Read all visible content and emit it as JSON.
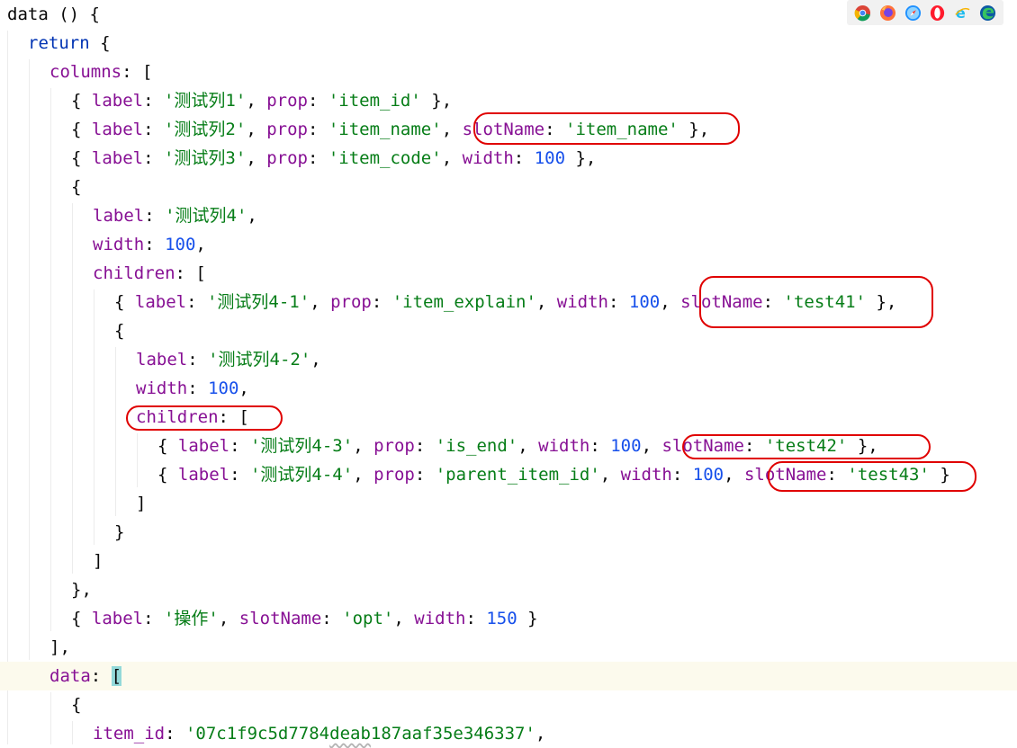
{
  "editor": {
    "lines": [
      {
        "tokens": [
          {
            "t": "data",
            "c": "p"
          },
          {
            "t": " () {",
            "c": "p"
          }
        ]
      },
      {
        "tokens": [
          {
            "t": "return",
            "c": "kw"
          },
          {
            "t": " {",
            "c": "p"
          }
        ]
      },
      {
        "tokens": [
          {
            "t": "columns",
            "c": "key"
          },
          {
            "t": ": [",
            "c": "p"
          }
        ]
      },
      {
        "tokens": [
          {
            "t": "{ ",
            "c": "p"
          },
          {
            "t": "label",
            "c": "key"
          },
          {
            "t": ": ",
            "c": "p"
          },
          {
            "t": "'测试列1'",
            "c": "str"
          },
          {
            "t": ", ",
            "c": "p"
          },
          {
            "t": "prop",
            "c": "key"
          },
          {
            "t": ": ",
            "c": "p"
          },
          {
            "t": "'item_id'",
            "c": "str"
          },
          {
            "t": " },",
            "c": "p"
          }
        ]
      },
      {
        "tokens": [
          {
            "t": "{ ",
            "c": "p"
          },
          {
            "t": "label",
            "c": "key"
          },
          {
            "t": ": ",
            "c": "p"
          },
          {
            "t": "'测试列2'",
            "c": "str"
          },
          {
            "t": ", ",
            "c": "p"
          },
          {
            "t": "prop",
            "c": "key"
          },
          {
            "t": ": ",
            "c": "p"
          },
          {
            "t": "'item_name'",
            "c": "str"
          },
          {
            "t": ", ",
            "c": "p"
          },
          {
            "t": "slotName",
            "c": "key"
          },
          {
            "t": ": ",
            "c": "p"
          },
          {
            "t": "'item_name'",
            "c": "str"
          },
          {
            "t": " },",
            "c": "p"
          }
        ]
      },
      {
        "tokens": [
          {
            "t": "{ ",
            "c": "p"
          },
          {
            "t": "label",
            "c": "key"
          },
          {
            "t": ": ",
            "c": "p"
          },
          {
            "t": "'测试列3'",
            "c": "str"
          },
          {
            "t": ", ",
            "c": "p"
          },
          {
            "t": "prop",
            "c": "key"
          },
          {
            "t": ": ",
            "c": "p"
          },
          {
            "t": "'item_code'",
            "c": "str"
          },
          {
            "t": ", ",
            "c": "p"
          },
          {
            "t": "width",
            "c": "key"
          },
          {
            "t": ": ",
            "c": "p"
          },
          {
            "t": "100",
            "c": "num"
          },
          {
            "t": " },",
            "c": "p"
          }
        ]
      },
      {
        "tokens": [
          {
            "t": "{",
            "c": "p"
          }
        ]
      },
      {
        "tokens": [
          {
            "t": "label",
            "c": "key"
          },
          {
            "t": ": ",
            "c": "p"
          },
          {
            "t": "'测试列4'",
            "c": "str"
          },
          {
            "t": ",",
            "c": "p"
          }
        ]
      },
      {
        "tokens": [
          {
            "t": "width",
            "c": "key"
          },
          {
            "t": ": ",
            "c": "p"
          },
          {
            "t": "100",
            "c": "num"
          },
          {
            "t": ",",
            "c": "p"
          }
        ]
      },
      {
        "tokens": [
          {
            "t": "children",
            "c": "key"
          },
          {
            "t": ": [",
            "c": "p"
          }
        ]
      },
      {
        "tokens": [
          {
            "t": "{ ",
            "c": "p"
          },
          {
            "t": "label",
            "c": "key"
          },
          {
            "t": ": ",
            "c": "p"
          },
          {
            "t": "'测试列4-1'",
            "c": "str"
          },
          {
            "t": ", ",
            "c": "p"
          },
          {
            "t": "prop",
            "c": "key"
          },
          {
            "t": ": ",
            "c": "p"
          },
          {
            "t": "'item_explain'",
            "c": "str"
          },
          {
            "t": ", ",
            "c": "p"
          },
          {
            "t": "width",
            "c": "key"
          },
          {
            "t": ": ",
            "c": "p"
          },
          {
            "t": "100",
            "c": "num"
          },
          {
            "t": ", ",
            "c": "p"
          },
          {
            "t": "slotName",
            "c": "key"
          },
          {
            "t": ": ",
            "c": "p"
          },
          {
            "t": "'test41'",
            "c": "str"
          },
          {
            "t": " },",
            "c": "p"
          }
        ]
      },
      {
        "tokens": [
          {
            "t": "{",
            "c": "p"
          }
        ]
      },
      {
        "tokens": [
          {
            "t": "label",
            "c": "key"
          },
          {
            "t": ": ",
            "c": "p"
          },
          {
            "t": "'测试列4-2'",
            "c": "str"
          },
          {
            "t": ",",
            "c": "p"
          }
        ]
      },
      {
        "tokens": [
          {
            "t": "width",
            "c": "key"
          },
          {
            "t": ": ",
            "c": "p"
          },
          {
            "t": "100",
            "c": "num"
          },
          {
            "t": ",",
            "c": "p"
          }
        ]
      },
      {
        "tokens": [
          {
            "t": "children",
            "c": "key"
          },
          {
            "t": ": [",
            "c": "p"
          }
        ]
      },
      {
        "tokens": [
          {
            "t": "{ ",
            "c": "p"
          },
          {
            "t": "label",
            "c": "key"
          },
          {
            "t": ": ",
            "c": "p"
          },
          {
            "t": "'测试列4-3'",
            "c": "str"
          },
          {
            "t": ", ",
            "c": "p"
          },
          {
            "t": "prop",
            "c": "key"
          },
          {
            "t": ": ",
            "c": "p"
          },
          {
            "t": "'is_end'",
            "c": "str"
          },
          {
            "t": ", ",
            "c": "p"
          },
          {
            "t": "width",
            "c": "key"
          },
          {
            "t": ": ",
            "c": "p"
          },
          {
            "t": "100",
            "c": "num"
          },
          {
            "t": ", ",
            "c": "p"
          },
          {
            "t": "slotName",
            "c": "key"
          },
          {
            "t": ": ",
            "c": "p"
          },
          {
            "t": "'test42'",
            "c": "str"
          },
          {
            "t": " },",
            "c": "p"
          }
        ]
      },
      {
        "tokens": [
          {
            "t": "{ ",
            "c": "p"
          },
          {
            "t": "label",
            "c": "key"
          },
          {
            "t": ": ",
            "c": "p"
          },
          {
            "t": "'测试列4-4'",
            "c": "str"
          },
          {
            "t": ", ",
            "c": "p"
          },
          {
            "t": "prop",
            "c": "key"
          },
          {
            "t": ": ",
            "c": "p"
          },
          {
            "t": "'parent_item_id'",
            "c": "str"
          },
          {
            "t": ", ",
            "c": "p"
          },
          {
            "t": "width",
            "c": "key"
          },
          {
            "t": ": ",
            "c": "p"
          },
          {
            "t": "100",
            "c": "num"
          },
          {
            "t": ", ",
            "c": "p"
          },
          {
            "t": "slotName",
            "c": "key"
          },
          {
            "t": ": ",
            "c": "p"
          },
          {
            "t": "'test43'",
            "c": "str"
          },
          {
            "t": " }",
            "c": "p"
          }
        ]
      },
      {
        "tokens": [
          {
            "t": "]",
            "c": "p"
          }
        ]
      },
      {
        "tokens": [
          {
            "t": "}",
            "c": "p"
          }
        ]
      },
      {
        "tokens": [
          {
            "t": "]",
            "c": "p"
          }
        ]
      },
      {
        "tokens": [
          {
            "t": "},",
            "c": "p"
          }
        ]
      },
      {
        "tokens": [
          {
            "t": "{ ",
            "c": "p"
          },
          {
            "t": "label",
            "c": "key"
          },
          {
            "t": ": ",
            "c": "p"
          },
          {
            "t": "'操作'",
            "c": "str"
          },
          {
            "t": ", ",
            "c": "p"
          },
          {
            "t": "slotName",
            "c": "key"
          },
          {
            "t": ": ",
            "c": "p"
          },
          {
            "t": "'opt'",
            "c": "str"
          },
          {
            "t": ", ",
            "c": "p"
          },
          {
            "t": "width",
            "c": "key"
          },
          {
            "t": ": ",
            "c": "p"
          },
          {
            "t": "150",
            "c": "num"
          },
          {
            "t": " }",
            "c": "p"
          }
        ]
      },
      {
        "tokens": [
          {
            "t": "],",
            "c": "p"
          }
        ]
      },
      {
        "tokens": [
          {
            "t": "data",
            "c": "key"
          },
          {
            "t": ": ",
            "c": "p"
          },
          {
            "t": "[",
            "c": "match"
          }
        ]
      },
      {
        "tokens": [
          {
            "t": "{",
            "c": "p"
          }
        ]
      },
      {
        "tokens": [
          {
            "t": "item_id",
            "c": "key"
          },
          {
            "t": ": ",
            "c": "p"
          },
          {
            "t": "'07c1f9c5d7784",
            "c": "str"
          },
          {
            "t": "deab",
            "c": "str-squiggle"
          },
          {
            "t": "187aaf35e346337'",
            "c": "str"
          },
          {
            "t": ",",
            "c": "p"
          }
        ]
      }
    ]
  },
  "browser_bar": {
    "icons": [
      "chrome-icon",
      "firefox-icon",
      "safari-icon",
      "opera-icon",
      "ie-icon",
      "edge-icon"
    ]
  },
  "annotations": {
    "color": "#e00000",
    "count": 6
  }
}
